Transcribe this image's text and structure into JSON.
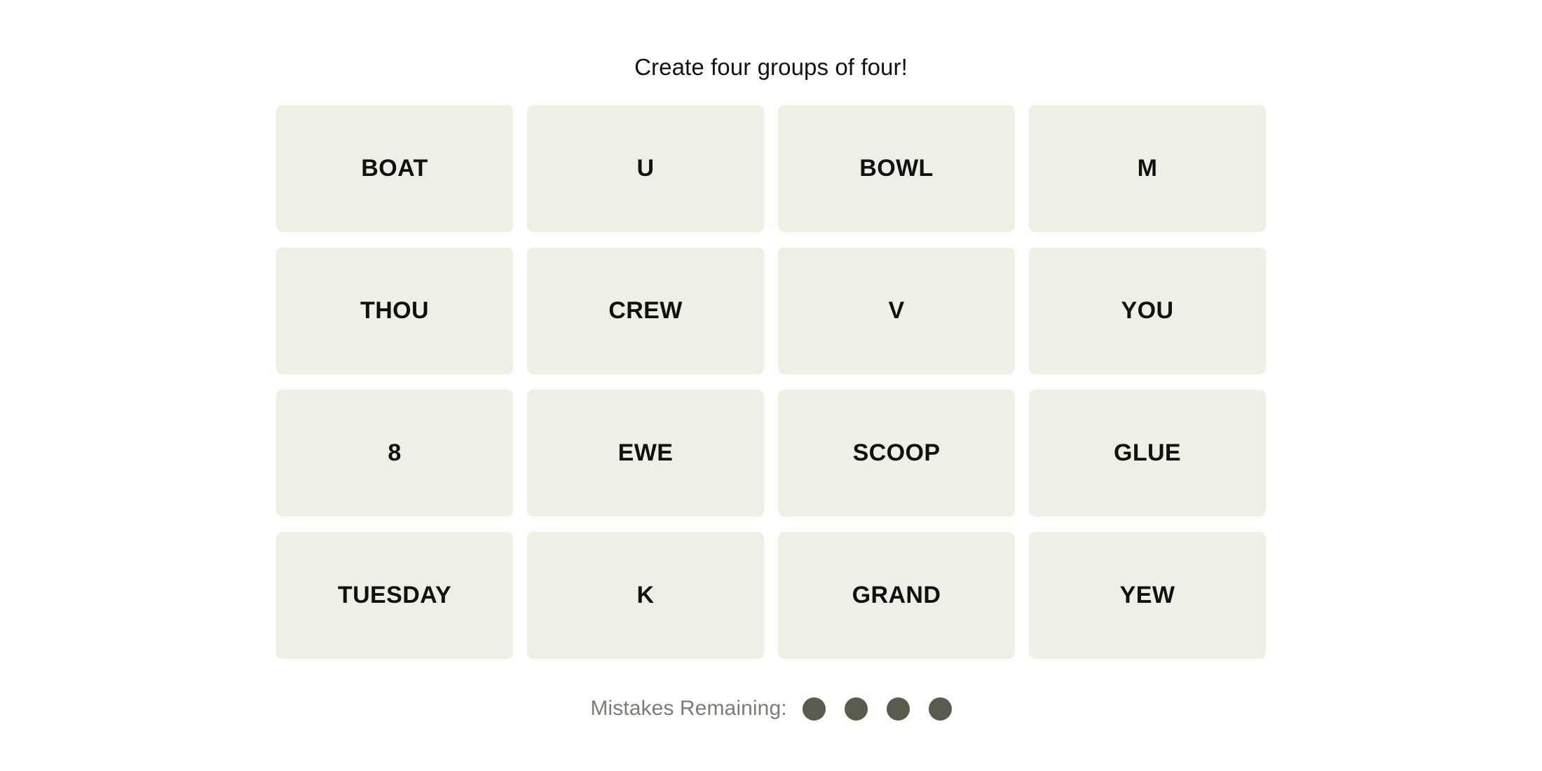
{
  "page": {
    "background_color": "#FFFFFF",
    "title": "Create four groups of four!"
  },
  "board": {
    "tile_color": "#EFEFE6",
    "tile_text_color": "#111111",
    "rows": 4,
    "columns": 4,
    "tiles": [
      {
        "label": "BOAT",
        "row": 1,
        "col": 1,
        "selected": false
      },
      {
        "label": "U",
        "row": 1,
        "col": 2,
        "selected": false
      },
      {
        "label": "BOWL",
        "row": 1,
        "col": 3,
        "selected": false
      },
      {
        "label": "M",
        "row": 1,
        "col": 4,
        "selected": false
      },
      {
        "label": "THOU",
        "row": 2,
        "col": 1,
        "selected": false
      },
      {
        "label": "CREW",
        "row": 2,
        "col": 2,
        "selected": false
      },
      {
        "label": "V",
        "row": 2,
        "col": 3,
        "selected": false
      },
      {
        "label": "YOU",
        "row": 2,
        "col": 4,
        "selected": false
      },
      {
        "label": "8",
        "row": 3,
        "col": 1,
        "selected": false
      },
      {
        "label": "EWE",
        "row": 3,
        "col": 2,
        "selected": false
      },
      {
        "label": "SCOOP",
        "row": 3,
        "col": 3,
        "selected": false
      },
      {
        "label": "GLUE",
        "row": 3,
        "col": 4,
        "selected": false
      },
      {
        "label": "TUESDAY",
        "row": 4,
        "col": 1,
        "selected": false
      },
      {
        "label": "K",
        "row": 4,
        "col": 2,
        "selected": false
      },
      {
        "label": "GRAND",
        "row": 4,
        "col": 3,
        "selected": false
      },
      {
        "label": "YEW",
        "row": 4,
        "col": 4,
        "selected": false
      }
    ]
  },
  "footer": {
    "mistakes_label": "Mistakes Remaining:",
    "mistakes_remaining": 4,
    "dot_color": "#5A5A4E",
    "label_color": "#7C7C74",
    "dots": [
      {
        "name": "mistake-dot-1",
        "filled": true
      },
      {
        "name": "mistake-dot-2",
        "filled": true
      },
      {
        "name": "mistake-dot-3",
        "filled": true
      },
      {
        "name": "mistake-dot-4",
        "filled": true
      }
    ]
  }
}
